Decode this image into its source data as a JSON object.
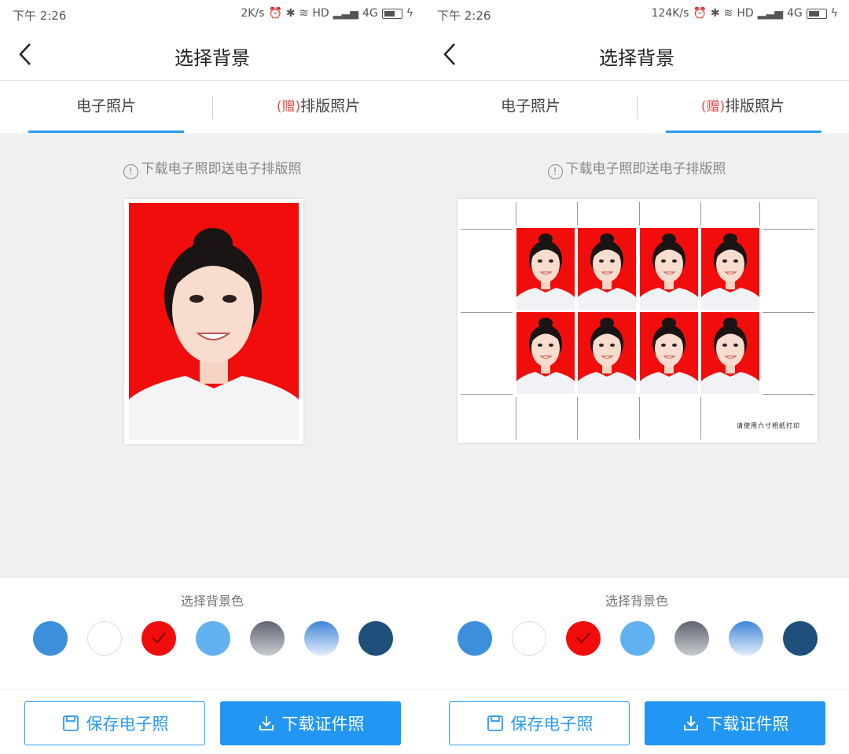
{
  "status_bar": {
    "left_time": "下午 2:26",
    "left_speed": "2K/s",
    "right_time": "下午 2:26",
    "right_speed": "124K/s",
    "hd": "HD",
    "network": "4G"
  },
  "header": {
    "title": "选择背景"
  },
  "tabs": {
    "electronic": "电子照片",
    "gift": "(赠)",
    "layout": "排版照片"
  },
  "notice": "下载电子照即送电子排版照",
  "sheet_note": "请使用六寸相纸打印",
  "bg_section": {
    "label": "选择背景色",
    "selected_index": 2,
    "colors": [
      "#3d8fdc",
      "#ffffff",
      "#f20d0d",
      "#61b0f0",
      "gradient-gray",
      "gradient-blue",
      "#1e4f7a"
    ]
  },
  "buttons": {
    "save": "保存电子照",
    "download": "下载证件照"
  },
  "colors": {
    "accent": "#2196f3",
    "photo_bg": "#f20d0d",
    "gift": "#e84a4a"
  }
}
